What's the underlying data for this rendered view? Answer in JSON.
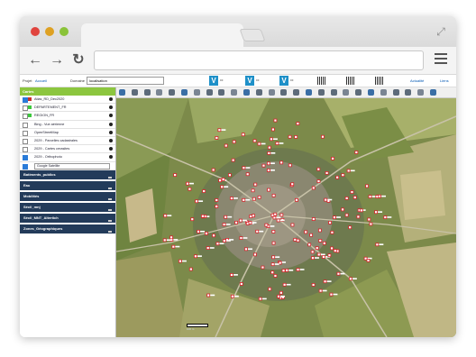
{
  "app": {
    "project_label": "Projet",
    "project_value": "Accueil",
    "domain_label": "Domaine",
    "localisation_value": "localisation",
    "actualite_label": "Actualité",
    "liens_label": "Liens"
  },
  "sidebar": {
    "header": "Cartes",
    "layers": [
      {
        "label": "Atlas_RD_Dec2020",
        "checked": true,
        "color": "#c8302b"
      },
      {
        "label": "DEPARTEMENT_FR",
        "checked": false,
        "color": "#3cc83c"
      },
      {
        "label": "REGION_FR",
        "checked": false,
        "color": "#3cc83c"
      },
      {
        "label": "Bing - Vue aérienne",
        "checked": false,
        "color": ""
      },
      {
        "label": "OpenStreetMap",
        "checked": false,
        "color": ""
      },
      {
        "label": "2029 - Parcelles cadastrales",
        "checked": false,
        "color": ""
      },
      {
        "label": "2029 - Cartes cerasites",
        "checked": false,
        "color": ""
      },
      {
        "label": "2029 - Orthophoto",
        "checked": true,
        "color": ""
      }
    ],
    "select_value": "Google Satellite",
    "groups": [
      "Batiments_publics",
      "Eau",
      "Mobilités",
      "Sécil_mnj",
      "Sécil_MNT_Altertich",
      "Zones_Géographiques"
    ]
  },
  "map": {
    "scale_label": "100 m"
  },
  "colors": {
    "accent_green": "#8cc63f",
    "group_navy": "#233b5a",
    "marker_red": "#d8232a"
  }
}
